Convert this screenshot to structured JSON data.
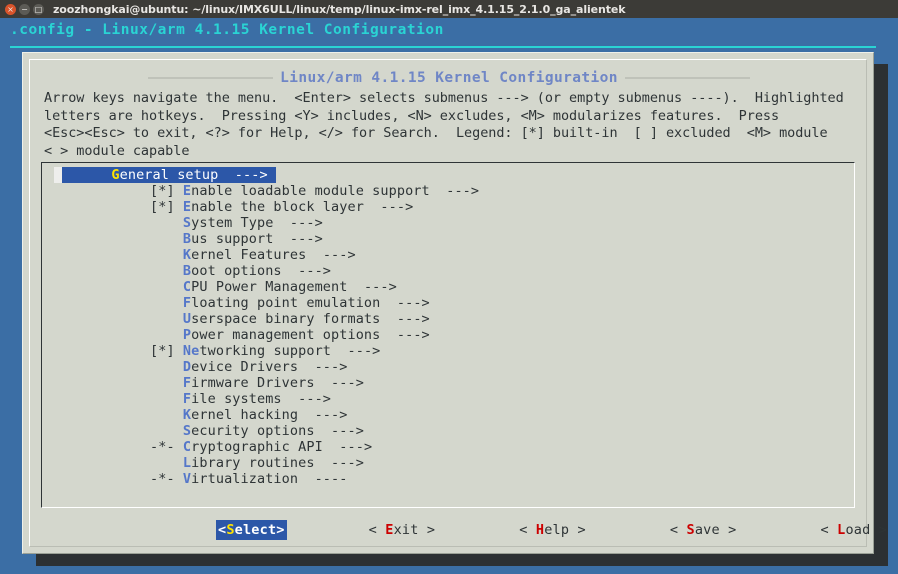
{
  "window": {
    "title": "zoozhongkai@ubuntu: ~/linux/IMX6ULL/linux/temp/linux-imx-rel_imx_4.1.15_2.1.0_ga_alientek",
    "controls": [
      {
        "name": "close",
        "glyph": "×"
      },
      {
        "name": "minimize",
        "glyph": "−"
      },
      {
        "name": "maximize",
        "glyph": "□"
      }
    ]
  },
  "terminal": {
    "header": ".config - Linux/arm 4.1.15 Kernel Configuration",
    "background_color": "#3b6ea5",
    "header_color": "#2ad4d4"
  },
  "dialog": {
    "title": "Linux/arm 4.1.15 Kernel Configuration",
    "title_color": "#6f86c6",
    "background_color": "#d4d7cd",
    "help_text": "Arrow keys navigate the menu.  <Enter> selects submenus ---> (or empty submenus ----).  Highlighted\nletters are hotkeys.  Pressing <Y> includes, <N> excludes, <M> modularizes features.  Press\n<Esc><Esc> to exit, <?> for Help, </> for Search.  Legend: [*] built-in  [ ] excluded  <M> module\n< > module capable"
  },
  "menu": {
    "selected_index": 0,
    "highlight_color": "#2c57a8",
    "hotkey_color": "#5577c9",
    "selected_hotkey_color": "#ffe300",
    "items": [
      {
        "flag": "   ",
        "hotkey": "G",
        "text": "eneral setup",
        "arrow": "--->"
      },
      {
        "flag": "[*]",
        "hotkey": "E",
        "text": "nable loadable module support",
        "arrow": "--->"
      },
      {
        "flag": "[*]",
        "hotkey": "E",
        "text": "nable the block layer",
        "arrow": "--->"
      },
      {
        "flag": "   ",
        "hotkey": "S",
        "text": "ystem Type",
        "arrow": "--->"
      },
      {
        "flag": "   ",
        "hotkey": "B",
        "text": "us support",
        "arrow": "--->"
      },
      {
        "flag": "   ",
        "hotkey": "K",
        "text": "ernel Features",
        "arrow": "--->"
      },
      {
        "flag": "   ",
        "hotkey": "B",
        "text": "oot options",
        "arrow": "--->"
      },
      {
        "flag": "   ",
        "hotkey": "C",
        "text": "PU Power Management",
        "arrow": "--->"
      },
      {
        "flag": "   ",
        "hotkey": "F",
        "text": "loating point emulation",
        "arrow": "--->"
      },
      {
        "flag": "   ",
        "hotkey": "U",
        "text": "serspace binary formats",
        "arrow": "--->"
      },
      {
        "flag": "   ",
        "hotkey": "P",
        "text": "ower management options",
        "arrow": "--->"
      },
      {
        "flag": "[*]",
        "hotkey": "Ne",
        "text": "tworking support",
        "arrow": "--->"
      },
      {
        "flag": "   ",
        "hotkey": "D",
        "text": "evice Drivers",
        "arrow": "--->"
      },
      {
        "flag": "   ",
        "hotkey": "F",
        "text": "irmware Drivers",
        "arrow": "--->"
      },
      {
        "flag": "   ",
        "hotkey": "F",
        "text": "ile systems",
        "arrow": "--->"
      },
      {
        "flag": "   ",
        "hotkey": "K",
        "text": "ernel hacking",
        "arrow": "--->"
      },
      {
        "flag": "   ",
        "hotkey": "S",
        "text": "ecurity options",
        "arrow": "--->"
      },
      {
        "flag": "-*-",
        "hotkey": "C",
        "text": "ryptographic API",
        "arrow": "--->"
      },
      {
        "flag": "   ",
        "hotkey": "L",
        "text": "ibrary routines",
        "arrow": "--->"
      },
      {
        "flag": "-*-",
        "hotkey": "V",
        "text": "irtualization",
        "arrow": "----"
      }
    ]
  },
  "buttons": [
    {
      "name": "select",
      "prefix": "<",
      "hotkey": "S",
      "text": "elect",
      "suffix": ">",
      "active": true
    },
    {
      "name": "exit",
      "prefix": "< ",
      "hotkey": "E",
      "text": "xit",
      "suffix": " >",
      "active": false
    },
    {
      "name": "help",
      "prefix": "< ",
      "hotkey": "H",
      "text": "elp",
      "suffix": " >",
      "active": false
    },
    {
      "name": "save",
      "prefix": "< ",
      "hotkey": "S",
      "text": "ave",
      "suffix": " >",
      "active": false
    },
    {
      "name": "load",
      "prefix": "< ",
      "hotkey": "L",
      "text": "oad",
      "suffix": " >",
      "active": false
    }
  ]
}
